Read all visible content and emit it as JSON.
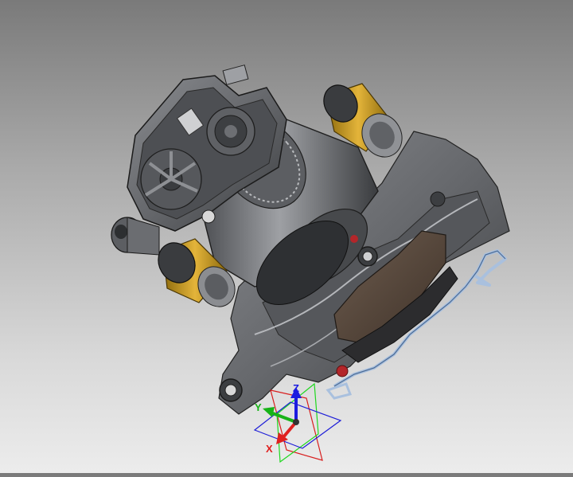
{
  "viewport": {
    "background_top": "#7a7a7a",
    "background_bottom": "#ececec",
    "model_colors": {
      "metal": "#6d6f72",
      "metal_dark": "#3e4043",
      "metal_light": "#9a9ca0",
      "brass": "#d4a21c",
      "brake_pad": "#5a4a3e",
      "spring_clip": "#9fb4d0",
      "red_detail": "#b3262a"
    }
  },
  "triad": {
    "x_label": "X",
    "y_label": "Y",
    "z_label": "Z",
    "x_color": "#e0201f",
    "y_color": "#17b317",
    "z_color": "#1c1ce0",
    "plane_xy_color": "#1e1ed8",
    "plane_xz_color": "#d81e1e",
    "plane_yz_color": "#1ed81e"
  }
}
